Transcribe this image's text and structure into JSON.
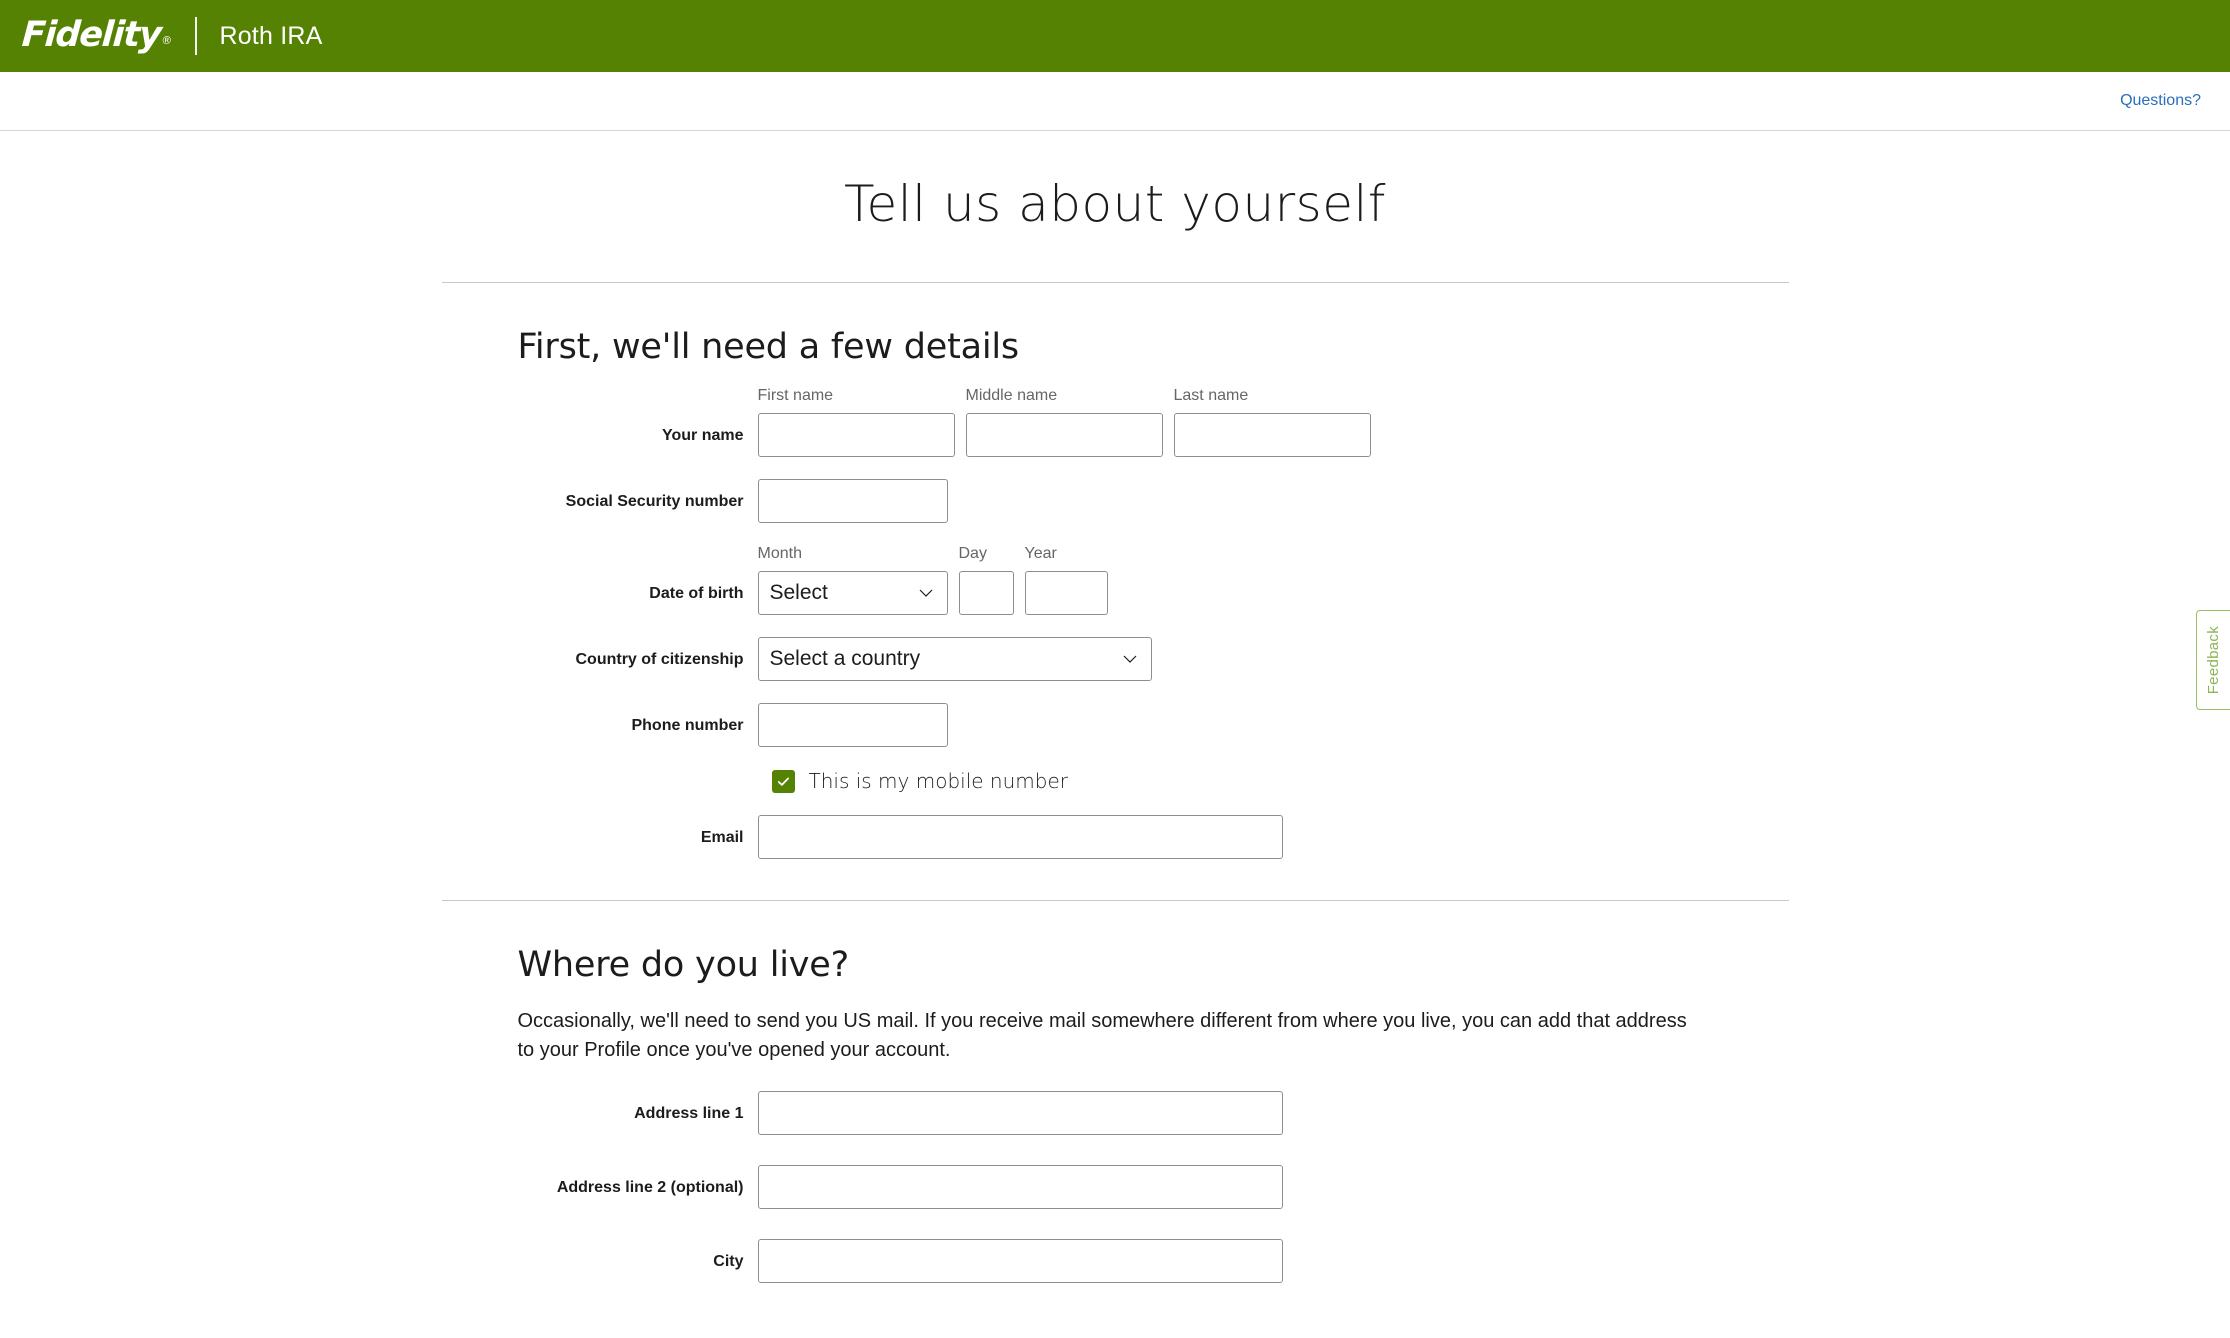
{
  "brand": {
    "logo_text": "Fidelity",
    "logo_registered": "®",
    "product": "Roth IRA",
    "green": "#568203"
  },
  "utility": {
    "questions_link": "Questions?",
    "link_color": "#2a6ebb"
  },
  "page": {
    "title": "Tell us about yourself"
  },
  "section_details": {
    "heading": "First, we'll need a few details",
    "rows": {
      "your_name": {
        "label": "Your name",
        "first": {
          "caption": "First name",
          "value": ""
        },
        "middle": {
          "caption": "Middle name",
          "value": ""
        },
        "last": {
          "caption": "Last name",
          "value": ""
        }
      },
      "ssn": {
        "label": "Social Security number",
        "value": ""
      },
      "dob": {
        "label": "Date of birth",
        "month": {
          "caption": "Month",
          "value": "Select"
        },
        "day": {
          "caption": "Day",
          "value": ""
        },
        "year": {
          "caption": "Year",
          "value": ""
        }
      },
      "citizenship": {
        "label": "Country of citizenship",
        "value": "Select a country"
      },
      "phone": {
        "label": "Phone number",
        "value": ""
      },
      "mobile_checkbox": {
        "label": "This is my mobile number",
        "checked": true
      },
      "email": {
        "label": "Email",
        "value": ""
      }
    }
  },
  "section_address": {
    "heading": "Where do you live?",
    "intro": "Occasionally, we'll need to send you US mail. If you receive mail somewhere different from where you live, you can add that address to your Profile once you've opened your account.",
    "rows": {
      "address1": {
        "label": "Address line 1",
        "value": ""
      },
      "address2": {
        "label": "Address line 2 (optional)",
        "value": ""
      },
      "city": {
        "label": "City",
        "value": ""
      }
    }
  },
  "feedback": {
    "label": "Feedback"
  }
}
